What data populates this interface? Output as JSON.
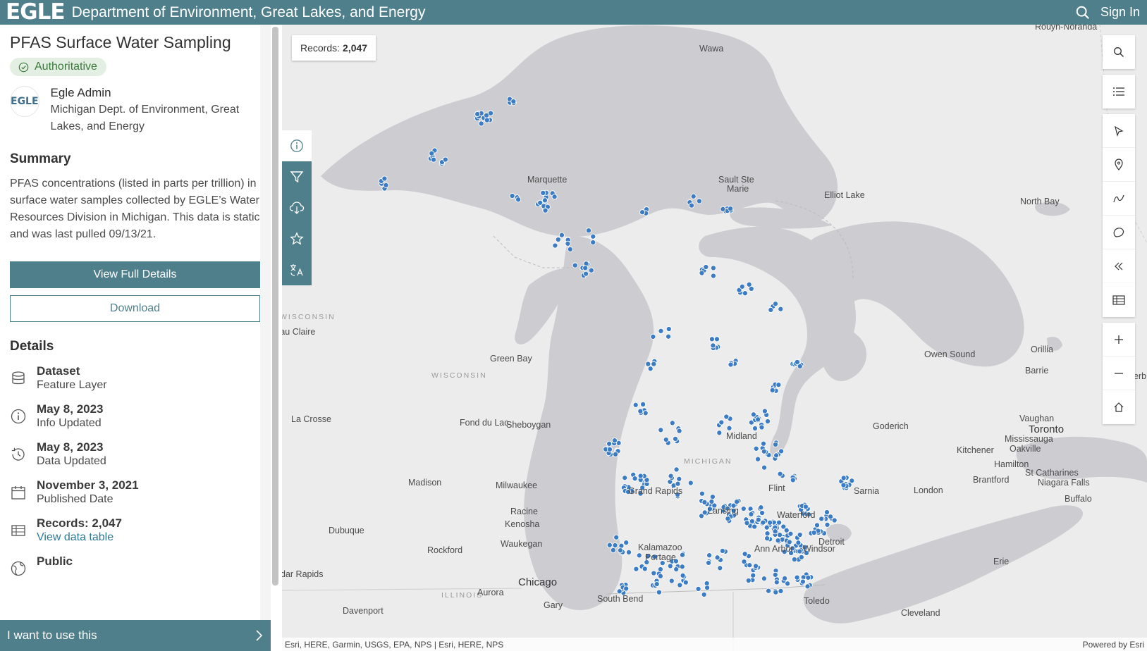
{
  "header": {
    "logo": "EGLE",
    "department": "Department of Environment, Great Lakes, and Energy",
    "sign_in": "Sign In",
    "search_icon": "search-icon"
  },
  "dataset": {
    "title": "PFAS Surface Water Sampling",
    "badge": "Authoritative",
    "owner_logo": "EGLE",
    "owner_name": "Egle Admin",
    "owner_org": "Michigan Dept. of Environment, Great Lakes, and Energy",
    "summary_heading": "Summary",
    "summary": "PFAS concentrations (listed in parts per trillion) in surface water samples collected by EGLE’s Water Resources Division in Michigan. This data is static and was last pulled 09/13/21.",
    "view_full_details": "View Full Details",
    "download": "Download",
    "details_heading": "Details",
    "details": [
      {
        "main": "Dataset",
        "sub": "Feature Layer",
        "icon": "database-icon"
      },
      {
        "main": "May 8, 2023",
        "sub": "Info Updated",
        "icon": "info-icon"
      },
      {
        "main": "May 8, 2023",
        "sub": "Data Updated",
        "icon": "history-icon"
      },
      {
        "main": "November 3, 2021",
        "sub": "Published Date",
        "icon": "calendar-icon"
      },
      {
        "main": "Records: 2,047",
        "link": "View data table",
        "icon": "table-icon"
      },
      {
        "main": "Public",
        "icon": "globe-icon"
      }
    ],
    "use_bar": "I want to use this"
  },
  "map": {
    "records_label": "Records:",
    "records_count": "2,047",
    "attribution": "Esri, HERE, Garmin, USGS, EPA, NPS | Esri, HERE, NPS",
    "powered_by": "Powered by Esri",
    "place_labels": [
      {
        "name": "Rouyn-Noranda"
      },
      {
        "name": "Wawa"
      },
      {
        "name": "Marquette"
      },
      {
        "name": "Sault Ste"
      },
      {
        "name": "Marie"
      },
      {
        "name": "Elliot Lake"
      },
      {
        "name": "North Bay"
      },
      {
        "name": "WISCONSIN"
      },
      {
        "name": "Eau Claire"
      },
      {
        "name": "Green Bay"
      },
      {
        "name": "WISCONSIN"
      },
      {
        "name": "Owen Sound"
      },
      {
        "name": "Orillia"
      },
      {
        "name": "Barrie"
      },
      {
        "name": "La Crosse"
      },
      {
        "name": "Fond du Lac"
      },
      {
        "name": "Sheboygan"
      },
      {
        "name": "Midland"
      },
      {
        "name": "Goderich"
      },
      {
        "name": "Vaughan"
      },
      {
        "name": "Toronto"
      },
      {
        "name": "Mississauga"
      },
      {
        "name": "Oakville"
      },
      {
        "name": "Kitchener"
      },
      {
        "name": "MICHIGAN"
      },
      {
        "name": "Hamilton"
      },
      {
        "name": "St Catharines"
      },
      {
        "name": "Niagara Falls"
      },
      {
        "name": "Madison"
      },
      {
        "name": "Milwaukee"
      },
      {
        "name": "Grand Rapids"
      },
      {
        "name": "Flint"
      },
      {
        "name": "Sarnia"
      },
      {
        "name": "London"
      },
      {
        "name": "Brantford"
      },
      {
        "name": "Buffalo"
      },
      {
        "name": "Racine"
      },
      {
        "name": "Kenosha"
      },
      {
        "name": "Lansing"
      },
      {
        "name": "Waterford"
      },
      {
        "name": "Dubuque"
      },
      {
        "name": "Waukegan"
      },
      {
        "name": "Detroit"
      },
      {
        "name": "Rockford"
      },
      {
        "name": "Kalamazoo"
      },
      {
        "name": "Ann Arbor"
      },
      {
        "name": "Windsor"
      },
      {
        "name": "Portage"
      },
      {
        "name": "Erie"
      },
      {
        "name": "dar Rapids"
      },
      {
        "name": "Chicago"
      },
      {
        "name": "ILLINOIS"
      },
      {
        "name": "Aurora"
      },
      {
        "name": "South Bend"
      },
      {
        "name": "Toledo"
      },
      {
        "name": "Gary"
      },
      {
        "name": "Davenport"
      },
      {
        "name": "Cleveland"
      },
      {
        "name": "erb"
      }
    ],
    "left_tools": [
      "info-icon",
      "filter-icon",
      "cloud-download-icon",
      "star-icon",
      "translate-icon"
    ],
    "right_tools_top": [
      "search-icon",
      "legend-list-icon"
    ],
    "right_tools_mid": [
      "point-icon",
      "pin-icon",
      "line-icon",
      "polygon-icon",
      "collapse-icon"
    ],
    "right_tools_table": [
      "table-icon"
    ],
    "right_tools_zoom": [
      "zoom-in-icon",
      "zoom-out-icon",
      "home-icon"
    ]
  },
  "colors": {
    "header_bg": "#4f7f8b",
    "water": "#ccccd1",
    "land": "#ececec",
    "point": "#3b7cc4",
    "badge_bg": "#e3efe3",
    "badge_text": "#3c7a3c"
  }
}
